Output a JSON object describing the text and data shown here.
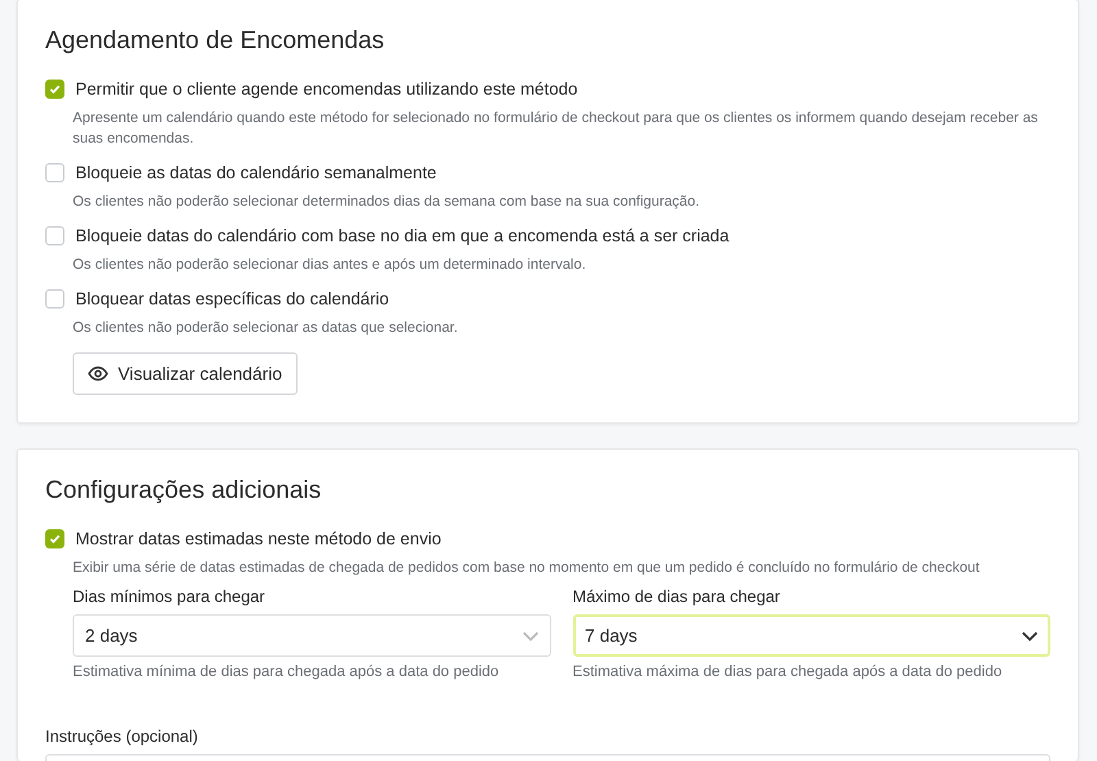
{
  "scheduling": {
    "title": "Agendamento de Encomendas",
    "options": [
      {
        "label": "Permitir que o cliente agende encomendas utilizando este método",
        "description": "Apresente um calendário quando este método for selecionado no formulário de checkout para que os clientes os informem quando desejam receber as suas encomendas.",
        "checked": true
      },
      {
        "label": "Bloqueie as datas do calendário semanalmente",
        "description": "Os clientes não poderão selecionar determinados dias da semana com base na sua configuração.",
        "checked": false
      },
      {
        "label": "Bloqueie datas do calendário com base no dia em que a encomenda está a ser criada",
        "description": "Os clientes não poderão selecionar dias antes e após um determinado intervalo.",
        "checked": false
      },
      {
        "label": "Bloquear datas específicas do calendário",
        "description": "Os clientes não poderão selecionar as datas que selecionar.",
        "checked": false
      }
    ],
    "button": "Visualizar calendário"
  },
  "additional": {
    "title": "Configurações adicionais",
    "option": {
      "label": "Mostrar datas estimadas neste método de envio",
      "description": "Exibir uma série de datas estimadas de chegada de pedidos com base no momento em que um pedido é concluído no formulário de checkout",
      "checked": true
    },
    "selects": [
      {
        "label": "Dias mínimos para chegar",
        "value": "2 days",
        "hint": "Estimativa mínima de dias para chegada após a data do pedido",
        "focused": false
      },
      {
        "label": "Máximo de dias para chegar",
        "value": "7 days",
        "hint": "Estimativa máxima de dias para chegada após a data do pedido",
        "focused": true
      }
    ],
    "instructions": {
      "label": "Instruções (opcional)"
    }
  }
}
